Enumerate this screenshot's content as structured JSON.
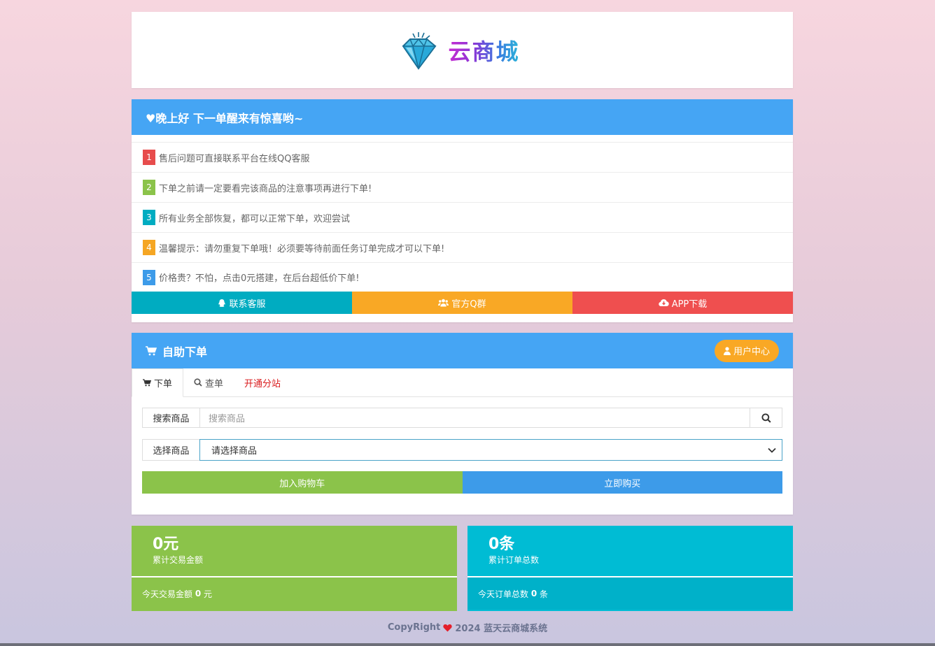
{
  "logo": {
    "text": "云商城"
  },
  "notice": {
    "title": "♥晚上好 下一单醒来有惊喜哟~",
    "items": [
      {
        "num": "1",
        "color": "#e74c4c",
        "text": "售后问题可直接联系平台在线QQ客服"
      },
      {
        "num": "2",
        "color": "#8bc34a",
        "text": "下单之前请一定要看完该商品的注意事项再进行下单!"
      },
      {
        "num": "3",
        "color": "#00acc1",
        "text": "所有业务全部恢复，都可以正常下单，欢迎尝试"
      },
      {
        "num": "4",
        "color": "#f5a623",
        "text": "温馨提示：请勿重复下单哦！必须要等待前面任务订单完成才可以下单!"
      },
      {
        "num": "5",
        "color": "#3d9be9",
        "text": "价格贵？不怕，点击0元搭建，在后台超低价下单!"
      }
    ],
    "buttons": {
      "contact": "联系客服",
      "qq_group": "官方Q群",
      "app": "APP下载"
    }
  },
  "order": {
    "title": "自助下单",
    "user_center": "用户中心",
    "tabs": {
      "order": "下单",
      "query": "查单",
      "substation": "开通分站"
    },
    "search_label": "搜索商品",
    "search_placeholder": "搜索商品",
    "select_label": "选择商品",
    "select_value": "请选择商品",
    "add_cart": "加入购物车",
    "buy_now": "立即购买"
  },
  "stats": {
    "amount": {
      "value": "0元",
      "label": "累计交易金额",
      "today_prefix": "今天交易金额",
      "today_value": "0",
      "today_unit": "元"
    },
    "orders": {
      "value": "0条",
      "label": "累计订单总数",
      "today_prefix": "今天订单总数",
      "today_value": "0",
      "today_unit": "条"
    }
  },
  "footer": {
    "left": "CopyRight",
    "right": "2024 蓝天云商城系统"
  },
  "colors": {
    "panel_header": "#45a5f4",
    "cyan": "#00acc1",
    "orange": "#f9a825",
    "red": "#ef4f4f",
    "green": "#8bc34a",
    "blue": "#3d9be9",
    "stat_cyan": "#00bcd4",
    "stat_cyan_dark": "#00b1c9"
  }
}
